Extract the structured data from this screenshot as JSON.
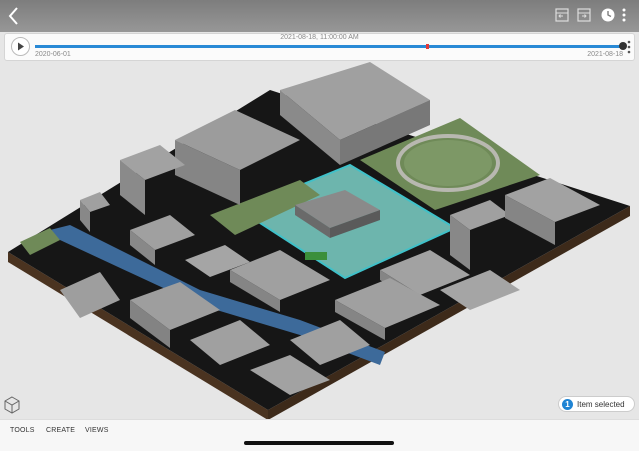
{
  "toolbar": {
    "back_icon": "chevron-left-icon",
    "icons": [
      "timeline-start-icon",
      "timeline-end-icon",
      "clock-icon",
      "more-vertical-icon"
    ]
  },
  "timeline": {
    "current_datetime": "2021-08-18, 11:00:00 AM",
    "start_date": "2020-06-01",
    "end_date": "2021-08-18",
    "play_icon": "play-icon",
    "position_fraction": 1.0,
    "marker_fraction": 0.67
  },
  "selection": {
    "count": "1",
    "label": "Item selected"
  },
  "bottom_tabs": [
    "TOOLS",
    "CREATE",
    "VIEWS"
  ],
  "colors": {
    "accent": "#2a8ad6",
    "marker": "#e23a3a",
    "selection_outline": "#3fc1c9"
  }
}
